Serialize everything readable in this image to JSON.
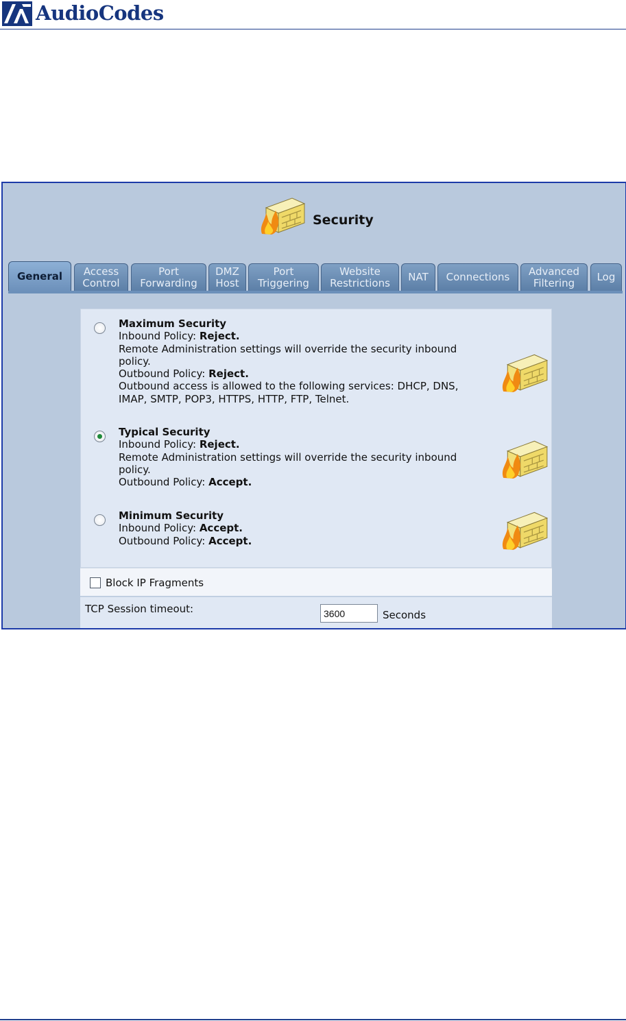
{
  "document": {
    "brand": "AudioCodes"
  },
  "page": {
    "title": "Security"
  },
  "tabs": [
    {
      "line1": "General",
      "line2": "",
      "active": true
    },
    {
      "line1": "Access",
      "line2": "Control",
      "active": false
    },
    {
      "line1": "Port",
      "line2": "Forwarding",
      "active": false
    },
    {
      "line1": "DMZ",
      "line2": "Host",
      "active": false
    },
    {
      "line1": "Port",
      "line2": "Triggering",
      "active": false
    },
    {
      "line1": "Website",
      "line2": "Restrictions",
      "active": false
    },
    {
      "line1": "NAT",
      "line2": "",
      "active": false
    },
    {
      "line1": "Connections",
      "line2": "",
      "active": false
    },
    {
      "line1": "Advanced",
      "line2": "Filtering",
      "active": false
    },
    {
      "line1": "Log",
      "line2": "",
      "active": false
    }
  ],
  "security_levels": {
    "maximum": {
      "title": "Maximum Security",
      "inbound_label": "Inbound Policy:",
      "inbound_value": "Reject.",
      "remote_note_1": "Remote Administration settings will override the security inbound",
      "remote_note_2": "policy.",
      "outbound_label": "Outbound Policy:",
      "outbound_value": "Reject.",
      "services_1": "Outbound access is allowed to the following services: DHCP, DNS,",
      "services_2": "IMAP, SMTP, POP3, HTTPS, HTTP, FTP, Telnet.",
      "selected": false
    },
    "typical": {
      "title": "Typical Security",
      "inbound_label": "Inbound Policy:",
      "inbound_value": "Reject.",
      "remote_note_1": "Remote Administration settings will override the security inbound",
      "remote_note_2": "policy.",
      "outbound_label": "Outbound Policy:",
      "outbound_value": "Accept.",
      "selected": true
    },
    "minimum": {
      "title": "Minimum Security",
      "inbound_label": "Inbound Policy:",
      "inbound_value": "Accept.",
      "outbound_label": "Outbound Policy:",
      "outbound_value": "Accept.",
      "selected": false
    }
  },
  "block_fragments": {
    "label": "Block IP Fragments",
    "checked": false
  },
  "tcp_timeout": {
    "label": "TCP Session timeout:",
    "value": "3600",
    "unit": "Seconds"
  },
  "colors": {
    "brand": "#16357e",
    "frame_border": "#1c3aa8",
    "frame_bg": "#b9c9dd",
    "tab": "#6c90ba",
    "panel": "#e0e8f4"
  },
  "icons": [
    "audiocodes-logo-icon",
    "firewall-icon"
  ]
}
